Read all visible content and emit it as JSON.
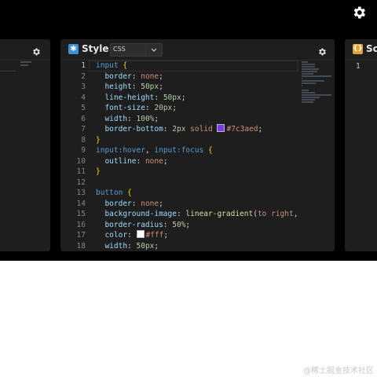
{
  "panels": {
    "style": {
      "title": "Style",
      "logo": "✱",
      "language": "CSS"
    },
    "script": {
      "title": "Scr",
      "logo": "{}",
      "line_number": "1"
    }
  },
  "icons": {
    "top_settings": "gear-icon",
    "panel_settings": "gear-icon",
    "dropdown": "chevron-down-icon"
  },
  "colors": {
    "accent": "#7c3aed",
    "swatch_white": "#ffffff",
    "swatch_gradient": "#4a90c2"
  },
  "editor": {
    "active_line": "1",
    "line_numbers": [
      "1",
      "2",
      "3",
      "4",
      "5",
      "6",
      "7",
      "8",
      "9",
      "10",
      "11",
      "12",
      "13",
      "14",
      "15",
      "16",
      "17",
      "18"
    ],
    "lines": [
      [
        {
          "t": "input ",
          "c": "sel"
        },
        {
          "t": "{",
          "c": "brace"
        }
      ],
      [
        {
          "t": "  border",
          "c": "prop"
        },
        {
          "t": ": ",
          "c": "pun"
        },
        {
          "t": "none",
          "c": "kw"
        },
        {
          "t": ";",
          "c": "pun"
        }
      ],
      [
        {
          "t": "  height",
          "c": "prop"
        },
        {
          "t": ": ",
          "c": "pun"
        },
        {
          "t": "50px",
          "c": "num"
        },
        {
          "t": ";",
          "c": "pun"
        }
      ],
      [
        {
          "t": "  line-height",
          "c": "prop"
        },
        {
          "t": ": ",
          "c": "pun"
        },
        {
          "t": "50px",
          "c": "num"
        },
        {
          "t": ";",
          "c": "pun"
        }
      ],
      [
        {
          "t": "  font-size",
          "c": "prop"
        },
        {
          "t": ": ",
          "c": "pun"
        },
        {
          "t": "20px",
          "c": "num"
        },
        {
          "t": ";",
          "c": "pun"
        }
      ],
      [
        {
          "t": "  width",
          "c": "prop"
        },
        {
          "t": ": ",
          "c": "pun"
        },
        {
          "t": "100%",
          "c": "num"
        },
        {
          "t": ";",
          "c": "pun"
        }
      ],
      [
        {
          "t": "  border-bottom",
          "c": "prop"
        },
        {
          "t": ": ",
          "c": "pun"
        },
        {
          "t": "2px ",
          "c": "num"
        },
        {
          "t": "solid ",
          "c": "kw"
        },
        {
          "t": "",
          "c": "swatch",
          "color": "#7c3aed"
        },
        {
          "t": "#7c3aed",
          "c": "kw"
        },
        {
          "t": ";",
          "c": "pun"
        }
      ],
      [
        {
          "t": "}",
          "c": "brace"
        }
      ],
      [
        {
          "t": "input:hover",
          "c": "sel"
        },
        {
          "t": ", ",
          "c": "pun"
        },
        {
          "t": "input:focus ",
          "c": "sel"
        },
        {
          "t": "{",
          "c": "brace"
        }
      ],
      [
        {
          "t": "  outline",
          "c": "prop"
        },
        {
          "t": ": ",
          "c": "pun"
        },
        {
          "t": "none",
          "c": "kw"
        },
        {
          "t": ";",
          "c": "pun"
        }
      ],
      [
        {
          "t": "}",
          "c": "brace"
        }
      ],
      [],
      [
        {
          "t": "button ",
          "c": "sel"
        },
        {
          "t": "{",
          "c": "brace"
        }
      ],
      [
        {
          "t": "  border",
          "c": "prop"
        },
        {
          "t": ": ",
          "c": "pun"
        },
        {
          "t": "none",
          "c": "kw"
        },
        {
          "t": ";",
          "c": "pun"
        }
      ],
      [
        {
          "t": "  background-image",
          "c": "prop"
        },
        {
          "t": ": ",
          "c": "pun"
        },
        {
          "t": "linear-gradient",
          "c": "fn"
        },
        {
          "t": "(",
          "c": "pun"
        },
        {
          "t": "to right",
          "c": "kw"
        },
        {
          "t": ", ",
          "c": "pun"
        },
        {
          "t": "",
          "c": "swatch",
          "color": "#4a90c2"
        }
      ],
      [
        {
          "t": "  border-radius",
          "c": "prop"
        },
        {
          "t": ": ",
          "c": "pun"
        },
        {
          "t": "50%",
          "c": "num"
        },
        {
          "t": ";",
          "c": "pun"
        }
      ],
      [
        {
          "t": "  color",
          "c": "prop"
        },
        {
          "t": ": ",
          "c": "pun"
        },
        {
          "t": "",
          "c": "swatch",
          "color": "#ffffff"
        },
        {
          "t": "#fff",
          "c": "kw"
        },
        {
          "t": ";",
          "c": "pun"
        }
      ],
      [
        {
          "t": "  width",
          "c": "prop"
        },
        {
          "t": ": ",
          "c": "pun"
        },
        {
          "t": "50px",
          "c": "num"
        },
        {
          "t": ";",
          "c": "pun"
        }
      ]
    ]
  },
  "watermark": "@稀土掘金技术社区"
}
